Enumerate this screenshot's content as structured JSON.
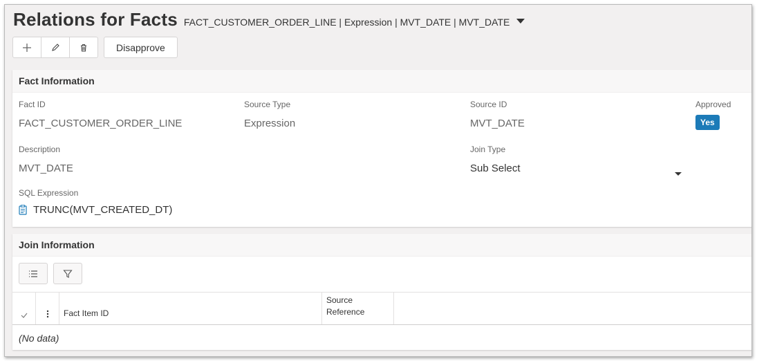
{
  "header": {
    "title": "Relations for Facts",
    "context": "FACT_CUSTOMER_ORDER_LINE | Expression | MVT_DATE | MVT_DATE"
  },
  "toolbar": {
    "add_icon": "plus-icon",
    "edit_icon": "pencil-icon",
    "delete_icon": "trash-icon",
    "disapprove_label": "Disapprove"
  },
  "fact_info": {
    "section_title": "Fact Information",
    "fact_id_label": "Fact ID",
    "fact_id_value": "FACT_CUSTOMER_ORDER_LINE",
    "source_type_label": "Source Type",
    "source_type_value": "Expression",
    "source_id_label": "Source ID",
    "source_id_value": "MVT_DATE",
    "approved_label": "Approved",
    "approved_value": "Yes",
    "description_label": "Description",
    "description_value": "MVT_DATE",
    "join_type_label": "Join Type",
    "join_type_value": "Sub Select",
    "sql_label": "SQL Expression",
    "sql_value": "TRUNC(MVT_CREATED_DT)"
  },
  "join_info": {
    "section_title": "Join Information",
    "columns": [
      "Fact Item ID",
      "Source Reference"
    ],
    "no_data": "(No data)"
  },
  "colors": {
    "accent": "#1c7bb8",
    "background": "#f2f0f0"
  }
}
